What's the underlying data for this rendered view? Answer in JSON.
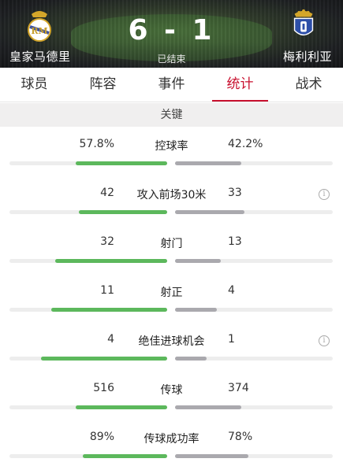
{
  "match": {
    "home_team": "皇家马德里",
    "away_team": "梅利利亚",
    "score": "6 - 1",
    "status": "已结束"
  },
  "tabs": [
    {
      "label": "球员",
      "active": false
    },
    {
      "label": "阵容",
      "active": false
    },
    {
      "label": "事件",
      "active": false
    },
    {
      "label": "统计",
      "active": true
    },
    {
      "label": "战术",
      "active": false
    }
  ],
  "section": {
    "title": "关键"
  },
  "colors": {
    "home_bar": "#5cb85c",
    "away_bar": "#aaa9ae",
    "accent": "#c8102e"
  },
  "stats": [
    {
      "label": "控球率",
      "home": "57.8%",
      "away": "42.2%",
      "home_fill": 0.578,
      "away_fill": 0.422,
      "info": false
    },
    {
      "label": "攻入前场30米",
      "home": "42",
      "away": "33",
      "home_fill": 0.56,
      "away_fill": 0.44,
      "info": true
    },
    {
      "label": "射门",
      "home": "32",
      "away": "13",
      "home_fill": 0.711,
      "away_fill": 0.289,
      "info": false
    },
    {
      "label": "射正",
      "home": "11",
      "away": "4",
      "home_fill": 0.733,
      "away_fill": 0.267,
      "info": false
    },
    {
      "label": "绝佳进球机会",
      "home": "4",
      "away": "1",
      "home_fill": 0.8,
      "away_fill": 0.2,
      "info": true
    },
    {
      "label": "传球",
      "home": "516",
      "away": "374",
      "home_fill": 0.58,
      "away_fill": 0.42,
      "info": false
    },
    {
      "label": "传球成功率",
      "home": "89%",
      "away": "78%",
      "home_fill": 0.533,
      "away_fill": 0.467,
      "info": false
    }
  ]
}
